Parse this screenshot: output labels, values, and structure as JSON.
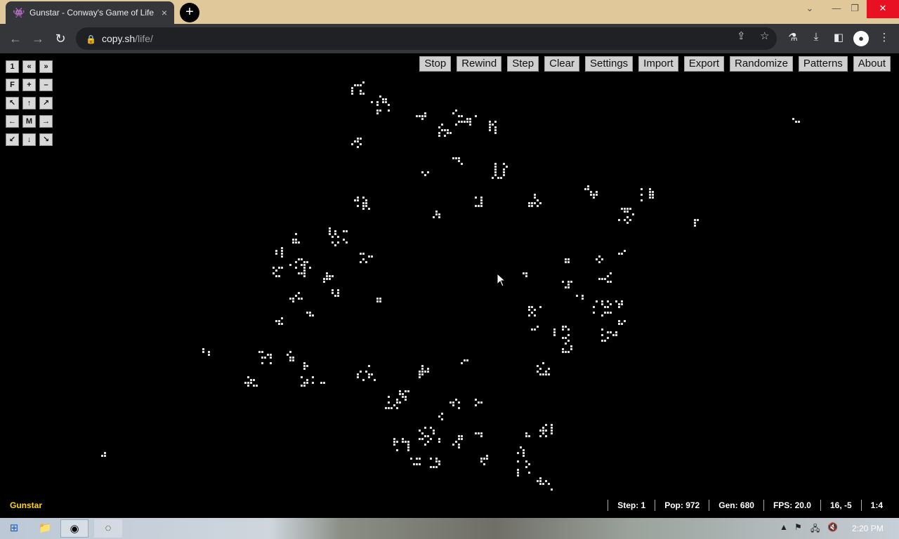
{
  "browser": {
    "tab_title": "Gunstar - Conway's Game of Life",
    "tab_close": "×",
    "new_tab": "+",
    "address_host": "copy.sh",
    "address_path": "/life/",
    "win_min": "—",
    "win_restore": "❐",
    "win_close": "✕",
    "win_chevron": "⌄"
  },
  "menu": [
    "Stop",
    "Rewind",
    "Step",
    "Clear",
    "Settings",
    "Import",
    "Export",
    "Randomize",
    "Patterns",
    "About"
  ],
  "controls": [
    [
      "1",
      "«",
      "»"
    ],
    [
      "F",
      "+",
      "–"
    ],
    [
      "↖",
      "↑",
      "↗"
    ],
    [
      "←",
      "M",
      "→"
    ],
    [
      "↙",
      "↓",
      "↘"
    ]
  ],
  "pattern_name": "Gunstar",
  "status": {
    "step": "Step: 1",
    "pop": "Pop: 972",
    "gen": "Gen: 680",
    "fps": "FPS: 20.0",
    "coords": "16, -5",
    "zoom": "1:4"
  },
  "taskbar": {
    "clock": "2:20 PM"
  }
}
